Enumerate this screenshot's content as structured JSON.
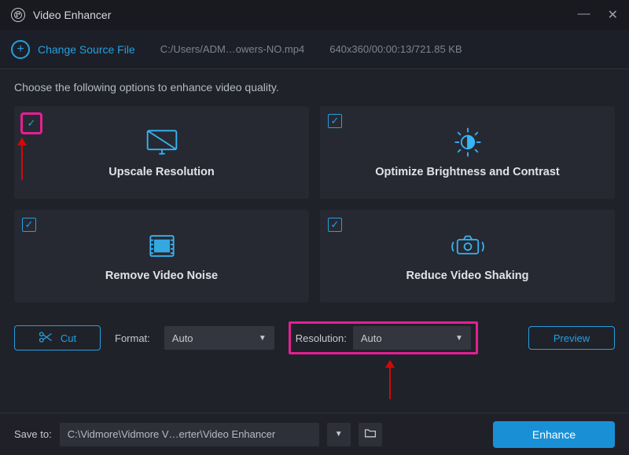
{
  "app": {
    "title": "Video Enhancer"
  },
  "toolbar": {
    "change_source_label": "Change Source File",
    "file_path": "C:/Users/ADM…owers-NO.mp4",
    "file_meta": "640x360/00:00:13/721.85 KB"
  },
  "main": {
    "instruction": "Choose the following options to enhance video quality.",
    "options": [
      {
        "title": "Upscale Resolution",
        "checked": true,
        "icon": "monitor-upscale-icon"
      },
      {
        "title": "Optimize Brightness and Contrast",
        "checked": true,
        "icon": "brightness-icon"
      },
      {
        "title": "Remove Video Noise",
        "checked": true,
        "icon": "film-noise-icon"
      },
      {
        "title": "Reduce Video Shaking",
        "checked": true,
        "icon": "camera-shake-icon"
      }
    ],
    "controls": {
      "cut_label": "Cut",
      "format_label": "Format:",
      "format_value": "Auto",
      "resolution_label": "Resolution:",
      "resolution_value": "Auto",
      "preview_label": "Preview"
    }
  },
  "bottom": {
    "save_to_label": "Save to:",
    "save_to_path": "C:\\Vidmore\\Vidmore V…erter\\Video Enhancer",
    "enhance_label": "Enhance"
  },
  "colors": {
    "accent": "#269fe2",
    "highlight": "#e61e93",
    "primary_button": "#1990d6"
  }
}
